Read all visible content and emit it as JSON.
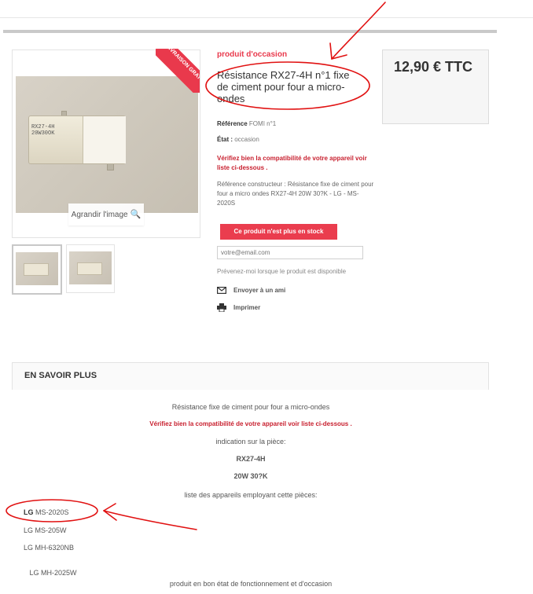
{
  "product": {
    "ribbon": "LIVRAISON GRATUITE",
    "condition_label": "produit d'occasion",
    "title": "Résistance RX27-4H n°1 fixe de ciment pour four a micro-ondes",
    "price": "12,90 € TTC",
    "reference_label": "Référence",
    "reference_value": "FOMI n°1",
    "state_label": "État :",
    "state_value": "occasion",
    "compat_note": "Vérifiez bien la compatibilité de votre appareil voir liste ci-dessous .",
    "description": " Référence constructeur : Résistance fixe de ciment pour four a micro ondes  RX27-4H 20W  30?K - LG - MS-2020S",
    "zoom_label": "Agrandir l'image",
    "resistor_print": [
      "RX27-4H",
      "20W30OK"
    ]
  },
  "stock": {
    "out_of_stock_label": "Ce produit n'est plus en stock",
    "email_placeholder": "votre@email.com",
    "notify_text": "Prévenez-moi lorsque le produit est disponible"
  },
  "actions": {
    "send_friend": "Envoyer à un ami",
    "print": "Imprimer"
  },
  "more_info": {
    "heading": "EN SAVOIR PLUS",
    "line1": "Résistance fixe de ciment pour four a micro-ondes",
    "compat": "Vérifiez bien la compatibilité de votre appareil voir liste ci-dessous .",
    "indication": "indication sur la pièce:",
    "part": "RX27-4H",
    "rating": "20W  30?K",
    "list_intro": "liste des appareils employant cette pièces:",
    "appliances": [
      {
        "brand": "LG",
        "model": "MS-2020S"
      },
      {
        "brand": "",
        "model": "LG MS-205W"
      },
      {
        "brand": "",
        "model": "LG MH-6320NB"
      },
      {
        "brand": "",
        "model": " LG MH-2025W"
      }
    ],
    "footer": "produit en bon état de fonctionnement et d'occasion"
  },
  "colors": {
    "accent_red": "#e9394c",
    "annotation_red": "#e11111"
  }
}
